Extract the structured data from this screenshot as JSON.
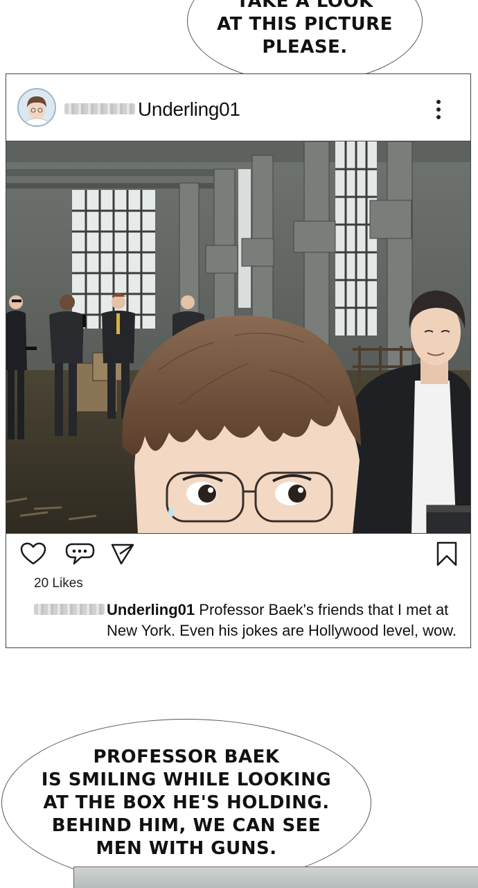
{
  "bubble_top": {
    "lines": [
      "TAKE A LOOK",
      "AT THIS PICTURE",
      "PLEASE."
    ]
  },
  "post": {
    "username": "Underling01",
    "likes": "20 Likes",
    "caption_username": "Underling01",
    "caption_line1": "Professor Baek's friends that I met at",
    "caption_line2": "New York. Even his jokes are Hollywood level, wow.",
    "icons": {
      "more": "more-vertical-icon",
      "like": "heart-icon",
      "comment": "comment-icon",
      "share": "send-icon",
      "save": "bookmark-icon"
    }
  },
  "bubble_bottom": {
    "lines": [
      "PROFESSOR BAEK",
      "IS SMILING WHILE LOOKING",
      "AT THE BOX HE'S HOLDING.",
      "BEHIND HIM, WE CAN SEE",
      "MEN WITH GUNS."
    ]
  }
}
